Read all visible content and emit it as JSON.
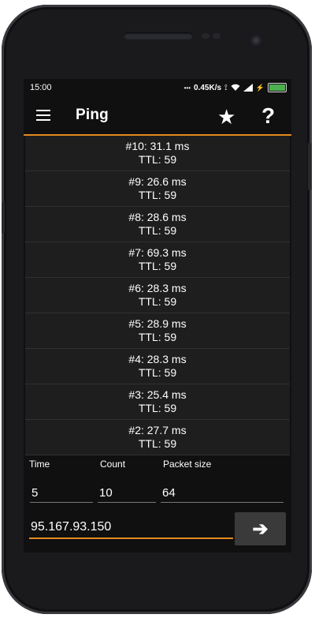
{
  "status": {
    "time": "15:00",
    "net_speed": "0.45K/s"
  },
  "toolbar": {
    "title": "Ping",
    "star_icon": "★",
    "help_icon": "?"
  },
  "results": [
    {
      "line1": "#10: 31.1 ms",
      "line2": "TTL: 59"
    },
    {
      "line1": "#9: 26.6 ms",
      "line2": "TTL: 59"
    },
    {
      "line1": "#8: 28.6 ms",
      "line2": "TTL: 59"
    },
    {
      "line1": "#7: 69.3 ms",
      "line2": "TTL: 59"
    },
    {
      "line1": "#6: 28.3 ms",
      "line2": "TTL: 59"
    },
    {
      "line1": "#5: 28.9 ms",
      "line2": "TTL: 59"
    },
    {
      "line1": "#4: 28.3 ms",
      "line2": "TTL: 59"
    },
    {
      "line1": "#3: 25.4 ms",
      "line2": "TTL: 59"
    },
    {
      "line1": "#2: 27.7 ms",
      "line2": "TTL: 59"
    }
  ],
  "settings": {
    "time_label": "Time",
    "count_label": "Count",
    "packet_size_label": "Packet size",
    "time_value": "5",
    "count_value": "10",
    "packet_size_value": "64"
  },
  "host": {
    "value": "95.167.93.150",
    "go_icon": "➔"
  },
  "colors": {
    "accent": "#e58a1f",
    "battery": "#4caf50",
    "background": "#101010"
  }
}
